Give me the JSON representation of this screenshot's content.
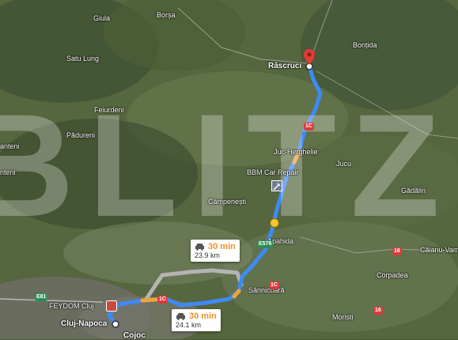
{
  "places": [
    {
      "id": "giula",
      "name": "Giula"
    },
    {
      "id": "borsa",
      "name": "Borșa"
    },
    {
      "id": "bontida",
      "name": "Bonțida"
    },
    {
      "id": "satu-lung",
      "name": "Satu Lung"
    },
    {
      "id": "feiurdeni",
      "name": "Feiurdeni"
    },
    {
      "id": "padureni",
      "name": "Pădureni"
    },
    {
      "id": "juc-herghelie",
      "name": "Juc-Herghelie"
    },
    {
      "id": "jucu",
      "name": "Jucu"
    },
    {
      "id": "gadalin",
      "name": "Gădălin"
    },
    {
      "id": "campenesti",
      "name": "Câmpenești"
    },
    {
      "id": "apahida",
      "name": "Apahida"
    },
    {
      "id": "sannicoara",
      "name": "Sânnicoară"
    },
    {
      "id": "corpadea",
      "name": "Corpadea"
    },
    {
      "id": "caianu-vamă",
      "name": "Căianu-Vam"
    },
    {
      "id": "moristi",
      "name": "Moriști"
    },
    {
      "id": "cojocna",
      "name": "Cojoc"
    },
    {
      "id": "lanteni",
      "name": "anteni"
    },
    {
      "id": "lanteni2",
      "name": "nteni"
    }
  ],
  "destination": {
    "name": "Răscruci"
  },
  "origin": {
    "name": "Cluj-Napoca"
  },
  "poi": [
    {
      "id": "bbm",
      "name": "BBM Car Repair"
    },
    {
      "id": "feydom",
      "name": "FEYDOM Cluj"
    }
  ],
  "road_badges": [
    {
      "id": "r1c-top",
      "text": "1C",
      "color": "#d93c3c"
    },
    {
      "id": "e576",
      "text": "E576",
      "color": "#2e8b57"
    },
    {
      "id": "r1c-mid",
      "text": "1C",
      "color": "#d93c3c"
    },
    {
      "id": "r1c-low",
      "text": "1C",
      "color": "#d93c3c"
    },
    {
      "id": "r16a",
      "text": "16",
      "color": "#d93c3c"
    },
    {
      "id": "r16b",
      "text": "16",
      "color": "#d93c3c"
    },
    {
      "id": "e81",
      "text": "E81",
      "color": "#2e8b57"
    }
  ],
  "routes": [
    {
      "id": "alt",
      "time": "30 min",
      "distance": "23.9 km"
    },
    {
      "id": "main",
      "time": "30 min",
      "distance": "24.1 km"
    }
  ],
  "watermark": "BLITZ",
  "colors": {
    "route_main": "#3d8af7",
    "route_alt": "#b4b4b4",
    "traffic": "#f2a33a",
    "time_text": "#e8912d",
    "pin": "#e53935"
  }
}
